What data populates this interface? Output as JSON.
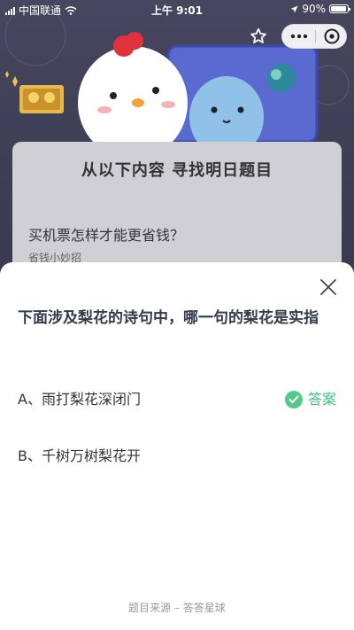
{
  "status_bar": {
    "carrier": "中国联通",
    "time": "上午 9:01",
    "battery": "90%"
  },
  "background": {
    "card_title": "从以下内容  寻找明日题目",
    "card_question": "买机票怎样才能更省钱？",
    "card_subtitle": "省钱小妙招"
  },
  "sheet": {
    "question": "下面涉及梨花的诗句中，哪一句的梨花是实指",
    "options": [
      {
        "label": "A、雨打梨花深闭门",
        "is_answer": true
      },
      {
        "label": "B、千树万树梨花开",
        "is_answer": false
      }
    ],
    "answer_label": "答案",
    "source": "题目来源 – 答答星球"
  },
  "colors": {
    "answer_green": "#54c98b",
    "question_text": "#333a4a"
  }
}
